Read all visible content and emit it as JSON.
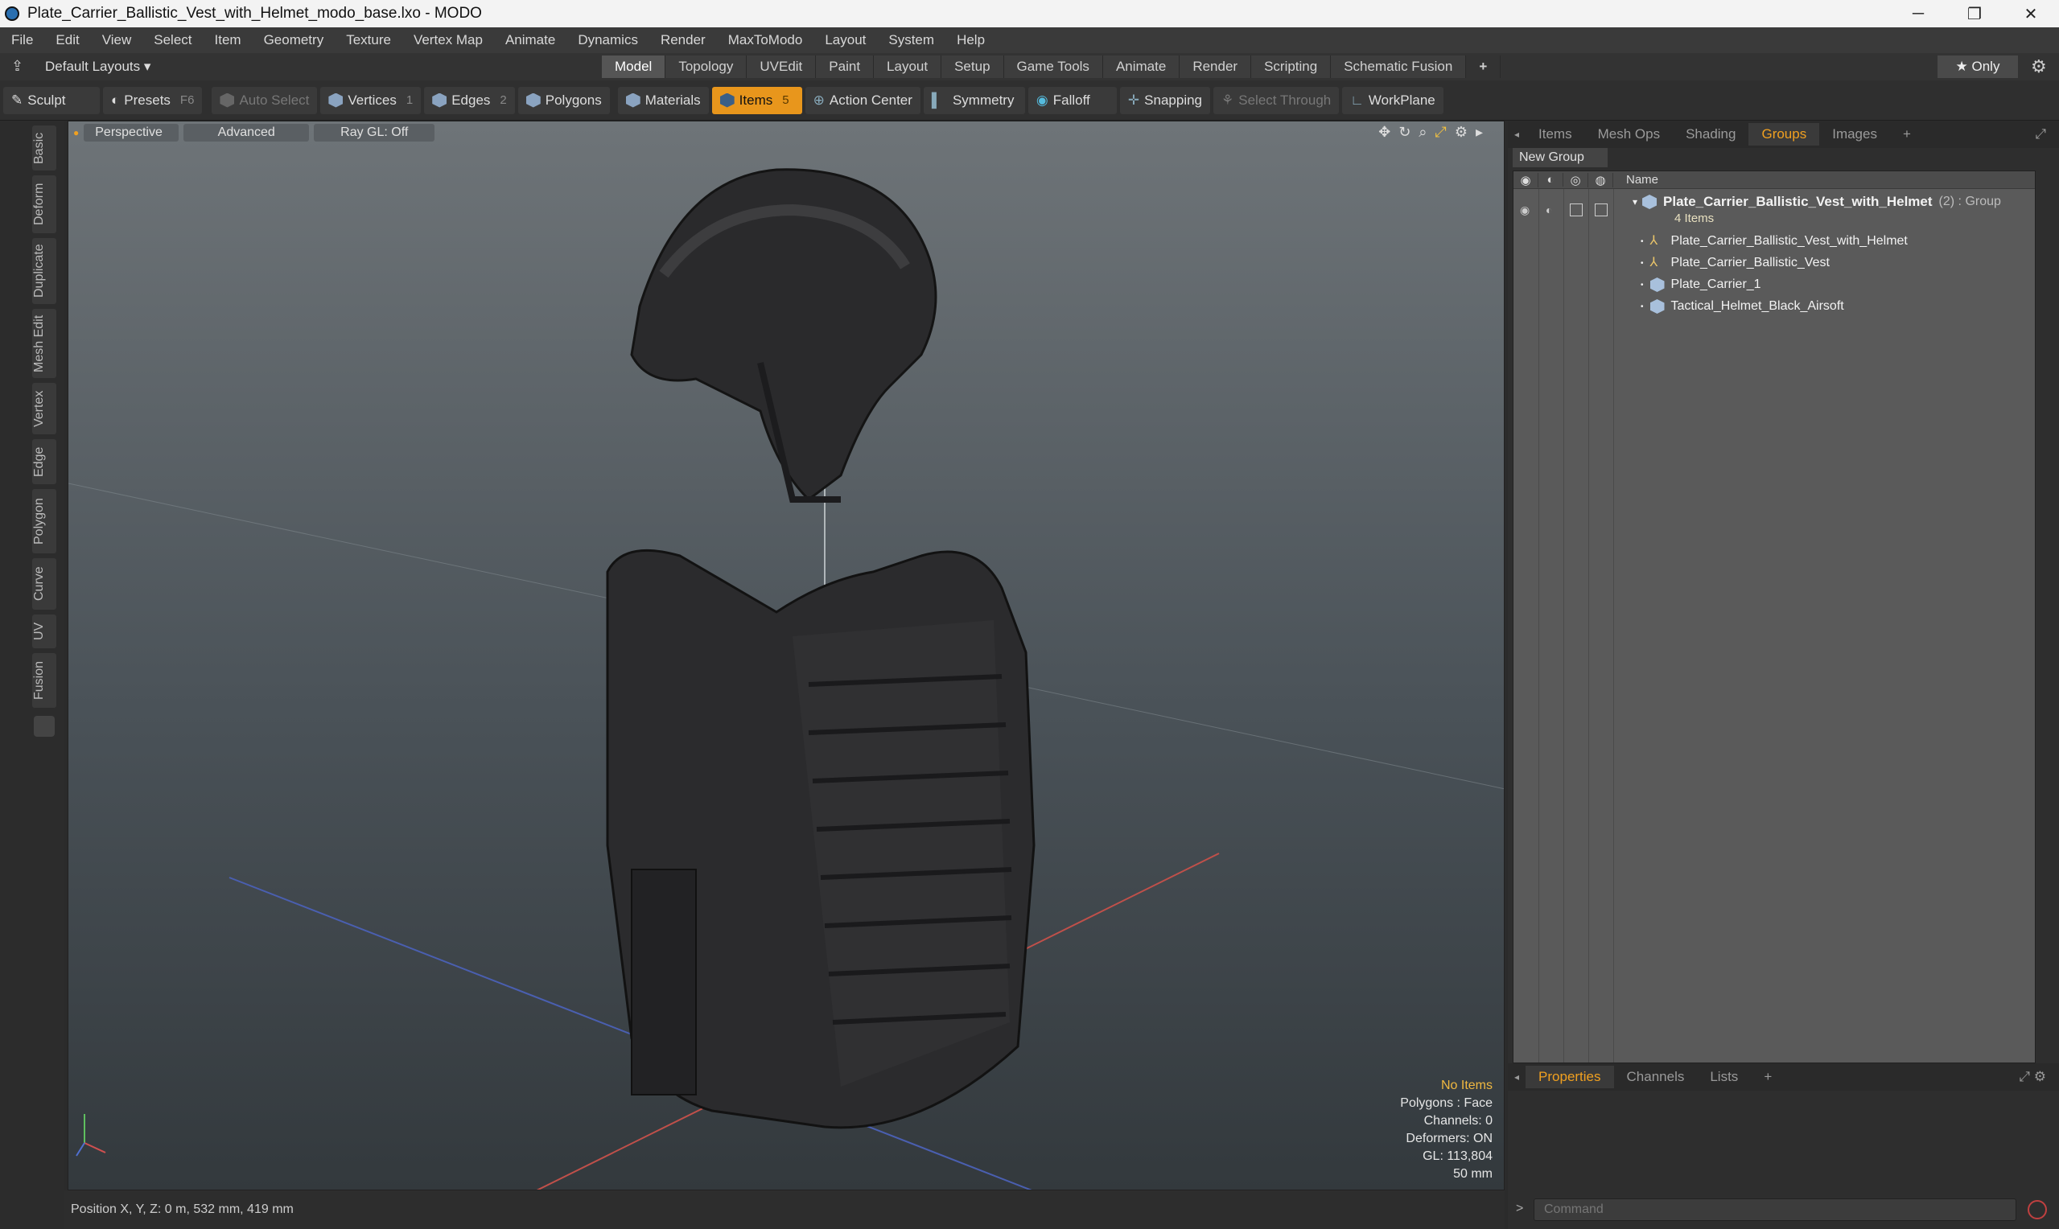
{
  "window": {
    "title": "Plate_Carrier_Ballistic_Vest_with_Helmet_modo_base.lxo - MODO",
    "minimize": "─",
    "restore": "❐",
    "close": "✕"
  },
  "menu": [
    "File",
    "Edit",
    "View",
    "Select",
    "Item",
    "Geometry",
    "Texture",
    "Vertex Map",
    "Animate",
    "Dynamics",
    "Render",
    "MaxToModo",
    "Layout",
    "System",
    "Help"
  ],
  "layout": {
    "default_layouts": "Default Layouts ▾",
    "only": "★  Only"
  },
  "tabs": [
    "Model",
    "Topology",
    "UVEdit",
    "Paint",
    "Layout",
    "Setup",
    "Game Tools",
    "Animate",
    "Render",
    "Scripting",
    "Schematic Fusion",
    "+"
  ],
  "toolbar": {
    "sculpt": "Sculpt",
    "presets": "Presets",
    "presets_key": "F6",
    "auto_select": "Auto Select",
    "vertices": "Vertices",
    "vertices_n": "1",
    "edges": "Edges",
    "edges_n": "2",
    "polygons": "Polygons",
    "materials": "Materials",
    "items": "Items",
    "items_n": "5",
    "action_center": "Action Center",
    "symmetry": "Symmetry",
    "falloff": "Falloff",
    "snapping": "Snapping",
    "select_through": "Select Through",
    "workplane": "WorkPlane"
  },
  "side_tabs": [
    "Basic",
    "Deform",
    "Duplicate",
    "Mesh Edit",
    "Vertex",
    "Edge",
    "Polygon",
    "Curve",
    "UV",
    "Fusion"
  ],
  "viewport": {
    "perspective": "Perspective",
    "advanced": "Advanced",
    "raygl": "Ray GL: Off"
  },
  "stats": {
    "no_items": "No Items",
    "polygons": "Polygons : Face",
    "channels": "Channels: 0",
    "deformers": "Deformers: ON",
    "gl": "GL: 113,804",
    "scale": "50 mm"
  },
  "status": {
    "position": "Position X, Y, Z:  0 m, 532 mm, 419 mm"
  },
  "right": {
    "tabs": [
      "Items",
      "Mesh Ops",
      "Shading",
      "Groups",
      "Images",
      "+"
    ],
    "new_group": "New Group",
    "name_col": "Name",
    "group": {
      "name": "Plate_Carrier_Ballistic_Vest_with_Helmet",
      "suffix": "(2) : Group",
      "count": "4 Items"
    },
    "items": [
      "Plate_Carrier_Ballistic_Vest_with_Helmet",
      "Plate_Carrier_Ballistic_Vest",
      "Plate_Carrier_1",
      "Tactical_Helmet_Black_Airsoft"
    ],
    "bottom_tabs": [
      "Properties",
      "Channels",
      "Lists",
      "+"
    ],
    "command_placeholder": "Command"
  },
  "colors": {
    "accent": "#e8961c"
  }
}
